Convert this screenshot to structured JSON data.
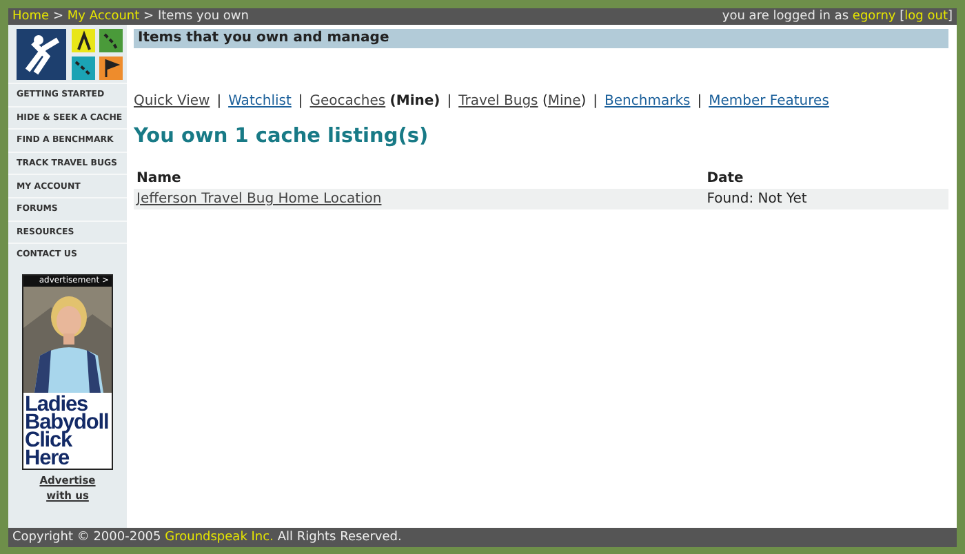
{
  "top_bar": {
    "breadcrumbs": [
      {
        "label": "Home",
        "link": true
      },
      {
        "label": "My Account",
        "link": true
      },
      {
        "label": "Items you own",
        "link": false
      }
    ],
    "separator": ">",
    "login_text": "you are logged in as",
    "username": "egorny",
    "logout_open": "[",
    "logout": "log out",
    "logout_close": "]"
  },
  "sidebar": {
    "items": [
      "GETTING STARTED",
      "HIDE & SEEK A CACHE",
      "FIND A BENCHMARK",
      "TRACK TRAVEL BUGS",
      "MY ACCOUNT",
      "FORUMS",
      "RESOURCES",
      "CONTACT US"
    ],
    "ad": {
      "caption": "advertisement >",
      "kind": "picture",
      "headline": "Ladies Babydoll Click Here"
    },
    "advertise_link": "Advertise with us"
  },
  "content": {
    "header": "Items that you own and manage",
    "nav_separator": "|",
    "nav": [
      {
        "label": "Quick View",
        "visited": true
      },
      {
        "label": "Watchlist",
        "visited": false
      },
      {
        "label": "Geocaches",
        "visited": true,
        "suffix": "(Mine)"
      },
      {
        "label": "Travel Bugs",
        "visited": true,
        "sub_link": "Mine",
        "paren_open": "(",
        "paren_close": ")"
      },
      {
        "label": "Benchmarks",
        "visited": false
      },
      {
        "label": "Member Features",
        "visited": false
      }
    ],
    "heading": "You own 1 cache listing(s)",
    "table": {
      "columns": [
        "Name",
        "Date"
      ],
      "rows": [
        {
          "name": "Jefferson Travel Bug Home Location",
          "date": "Found: Not Yet"
        }
      ]
    }
  },
  "footer": {
    "before": "Copyright © 2000-2005",
    "company": "Groundspeak Inc.",
    "after": "All Rights Reserved."
  }
}
